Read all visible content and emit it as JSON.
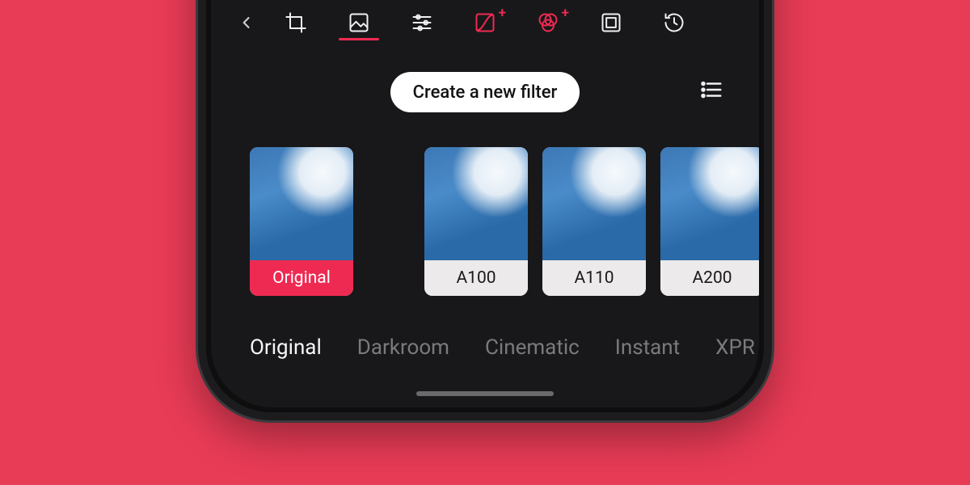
{
  "accent": "#ef2a52",
  "toolbar": {
    "back_icon": "chevron-left",
    "tools": [
      {
        "name": "crop-icon",
        "active": false
      },
      {
        "name": "picture-icon",
        "active": true
      },
      {
        "name": "sliders-icon",
        "active": false
      },
      {
        "name": "curves-icon",
        "active": false,
        "badge": "+",
        "accent": true
      },
      {
        "name": "channels-icon",
        "active": false,
        "badge": "+",
        "accent": true
      },
      {
        "name": "frame-icon",
        "active": false
      },
      {
        "name": "history-icon",
        "active": false
      }
    ]
  },
  "create_filter": {
    "label": "Create a new filter",
    "list_icon": "list-icon"
  },
  "filters": [
    {
      "label": "Original",
      "selected": true
    },
    {
      "label": "A100",
      "selected": false
    },
    {
      "label": "A110",
      "selected": false
    },
    {
      "label": "A200",
      "selected": false
    }
  ],
  "categories": [
    {
      "label": "Original",
      "active": true
    },
    {
      "label": "Darkroom",
      "active": false
    },
    {
      "label": "Cinematic",
      "active": false
    },
    {
      "label": "Instant",
      "active": false
    },
    {
      "label": "XPR",
      "active": false
    }
  ]
}
